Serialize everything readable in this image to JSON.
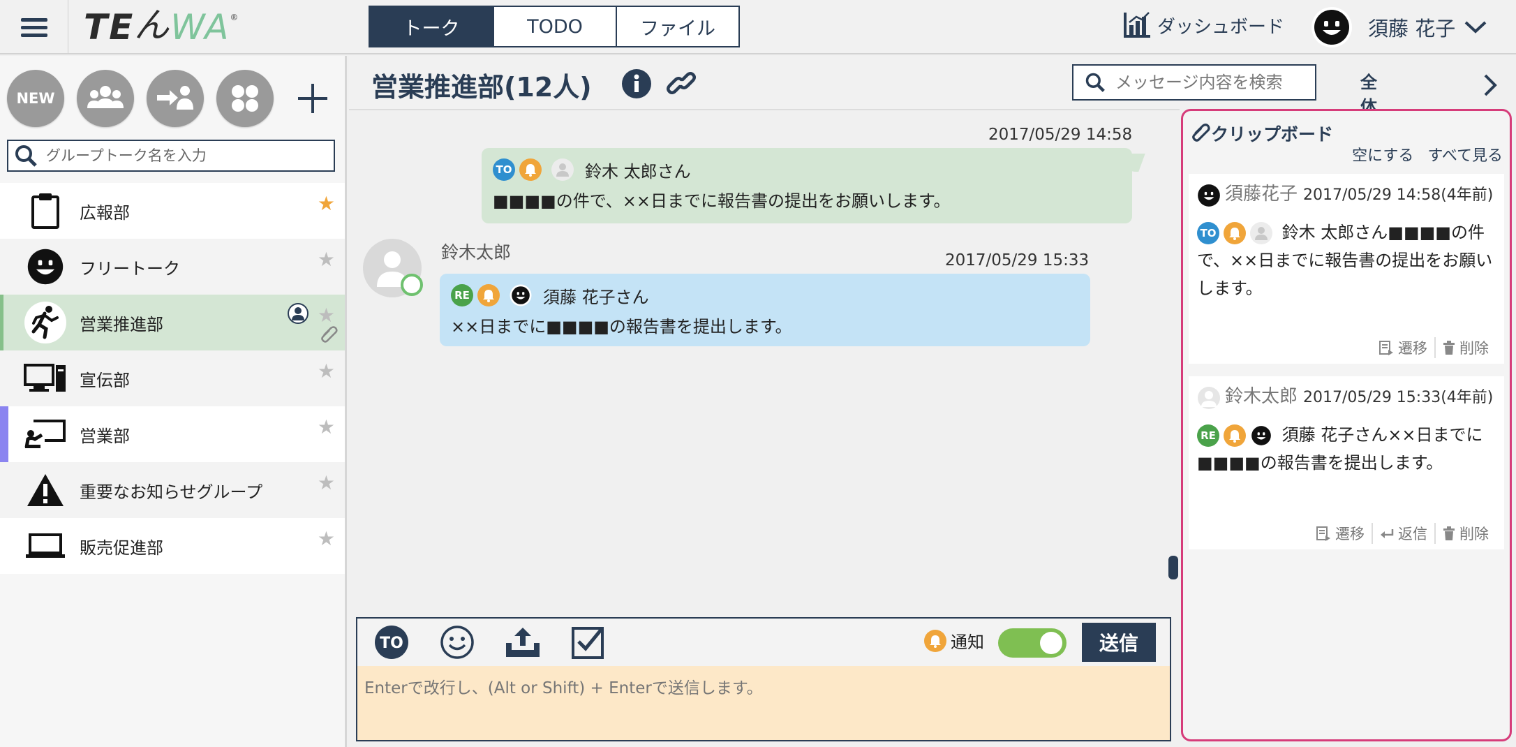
{
  "header": {
    "logo_te": "TE",
    "logo_h": "ん",
    "logo_wa": "WA",
    "logo_reg": "®",
    "tabs": [
      {
        "label": "トーク",
        "active": true
      },
      {
        "label": "TODO",
        "active": false
      },
      {
        "label": "ファイル",
        "active": false
      }
    ],
    "dashboard_label": "ダッシュボード",
    "user_name": "須藤 花子"
  },
  "sidebar": {
    "new_label": "NEW",
    "search_placeholder": "グループトーク名を入力",
    "groups": [
      {
        "name": "広報部",
        "icon": "clipboard-icon",
        "favorite": true
      },
      {
        "name": "フリートーク",
        "icon": "smiley-icon",
        "favorite": false
      },
      {
        "name": "営業推進部",
        "icon": "runner-icon",
        "favorite": false,
        "active": true
      },
      {
        "name": "宣伝部",
        "icon": "desktop-icon",
        "favorite": false
      },
      {
        "name": "営業部",
        "icon": "presentation-icon",
        "favorite": false
      },
      {
        "name": "重要なお知らせグループ",
        "icon": "warning-icon",
        "favorite": false
      },
      {
        "name": "販売促進部",
        "icon": "laptop-icon",
        "favorite": false
      }
    ]
  },
  "chat": {
    "title": "営業推進部(12人)",
    "search_placeholder": "メッセージ内容を検索",
    "global_search_label": "全体を検索",
    "messages": [
      {
        "timestamp": "2017/05/29 14:58",
        "to_label": "TO",
        "recipient": "鈴木 太郎さん",
        "text": "■■■■の件で、××日までに報告書の提出をお願いします。"
      },
      {
        "sender": "鈴木太郎",
        "timestamp": "2017/05/29 15:33",
        "re_label": "RE",
        "recipient": "須藤 花子さん",
        "text": "××日までに■■■■の報告書を提出します。"
      }
    ],
    "composer": {
      "to_label": "TO",
      "notify_label": "通知",
      "send_label": "送信",
      "placeholder": "Enterで改行し、(Alt or Shift) + Enterで送信します。"
    }
  },
  "clipboard": {
    "title": "クリップボード",
    "clear_label": "空にする",
    "view_all_label": "すべて見る",
    "items": [
      {
        "name": "須藤花子",
        "timestamp": "2017/05/29 14:58(4年前)",
        "tag_label": "TO",
        "text": "鈴木 太郎さん■■■■の件で、××日までに報告書の提出をお願いします。",
        "tools": [
          "遷移",
          "削除"
        ]
      },
      {
        "name": "鈴木太郎",
        "timestamp": "2017/05/29 15:33(4年前)",
        "tag_label": "RE",
        "text": "須藤 花子さん××日までに■■■■の報告書を提出します。",
        "tools": [
          "遷移",
          "返信",
          "削除"
        ]
      }
    ]
  },
  "colors": {
    "navy": "#2a3d55",
    "active_group": "#d4e6d4",
    "my_bubble": "#d4e6d4",
    "their_bubble": "#c4e3f6",
    "composer": "#fde8c8",
    "clipboard_border": "#d63c7a",
    "favorite_star": "#f0a53a",
    "toggle_on": "#7fbf52"
  }
}
